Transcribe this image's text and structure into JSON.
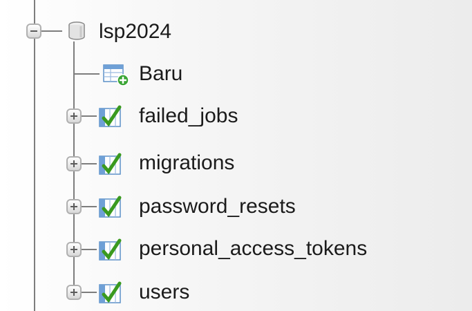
{
  "tree": {
    "database": {
      "name": "lsp2024",
      "icon": "database-icon",
      "toggle": "collapse"
    },
    "new_item": {
      "label": "Baru",
      "icon": "new-table-icon"
    },
    "tables": [
      {
        "name": "failed_jobs",
        "icon": "table-icon",
        "toggle": "expand"
      },
      {
        "name": "migrations",
        "icon": "table-icon",
        "toggle": "expand"
      },
      {
        "name": "password_resets",
        "icon": "table-icon",
        "toggle": "expand"
      },
      {
        "name": "personal_access_tokens",
        "icon": "table-icon",
        "toggle": "expand"
      },
      {
        "name": "users",
        "icon": "table-icon",
        "toggle": "expand"
      }
    ]
  },
  "colors": {
    "connector": "#7d7d7d",
    "text": "#1b1b1b",
    "table_icon_green": "#3a9a1f",
    "table_icon_blue": "#4a86c8"
  }
}
